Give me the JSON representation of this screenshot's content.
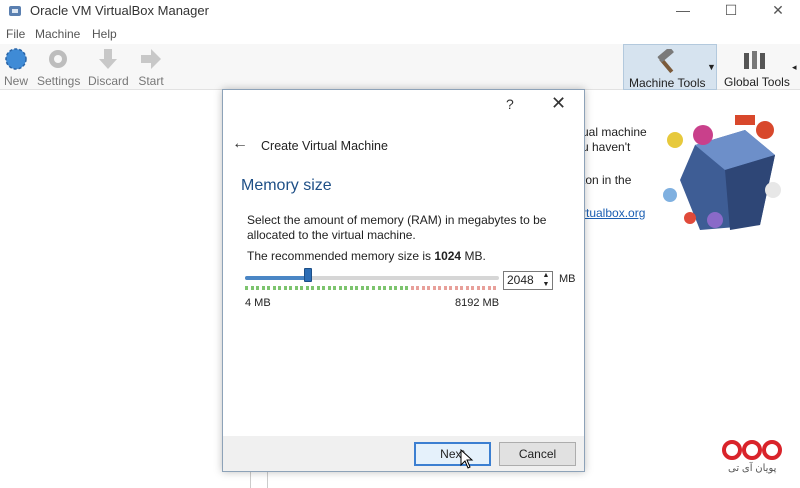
{
  "window": {
    "title": "Oracle VM VirtualBox Manager",
    "controls": {
      "minimize": "—",
      "maximize": "☐",
      "close": "✕"
    }
  },
  "menubar": {
    "items": [
      "File",
      "Machine",
      "Help"
    ]
  },
  "toolbar": {
    "new_label": "New",
    "settings_label": "Settings",
    "discard_label": "Discard",
    "start_label": "Start",
    "machine_tools_label": "Machine Tools",
    "global_tools_label": "Global Tools"
  },
  "welcome": {
    "lines": [
      "ual machine",
      "u haven't",
      "ton in the",
      "rtualbox.org"
    ]
  },
  "logo": {
    "text": "پویان آی تی"
  },
  "dialog": {
    "help_button": "?",
    "close_button": "✕",
    "wizard_title": "Create Virtual Machine",
    "page_heading": "Memory size",
    "description": "Select the amount of memory (RAM) in megabytes to be allocated to the virtual machine.",
    "recommended_prefix": "The recommended memory size is ",
    "recommended_value": "1024",
    "recommended_suffix": " MB.",
    "slider": {
      "min_label": "4 MB",
      "max_label": "8192 MB",
      "value": 2048,
      "min": 4,
      "max": 8192
    },
    "spinbox_value": "2048",
    "unit_label": "MB",
    "next_button": "Next",
    "cancel_button": "Cancel"
  },
  "colors": {
    "accent": "#2c6db5",
    "heading": "#1e4f86",
    "tick_green": "#7dc46e",
    "tick_red": "#e8a09a"
  }
}
